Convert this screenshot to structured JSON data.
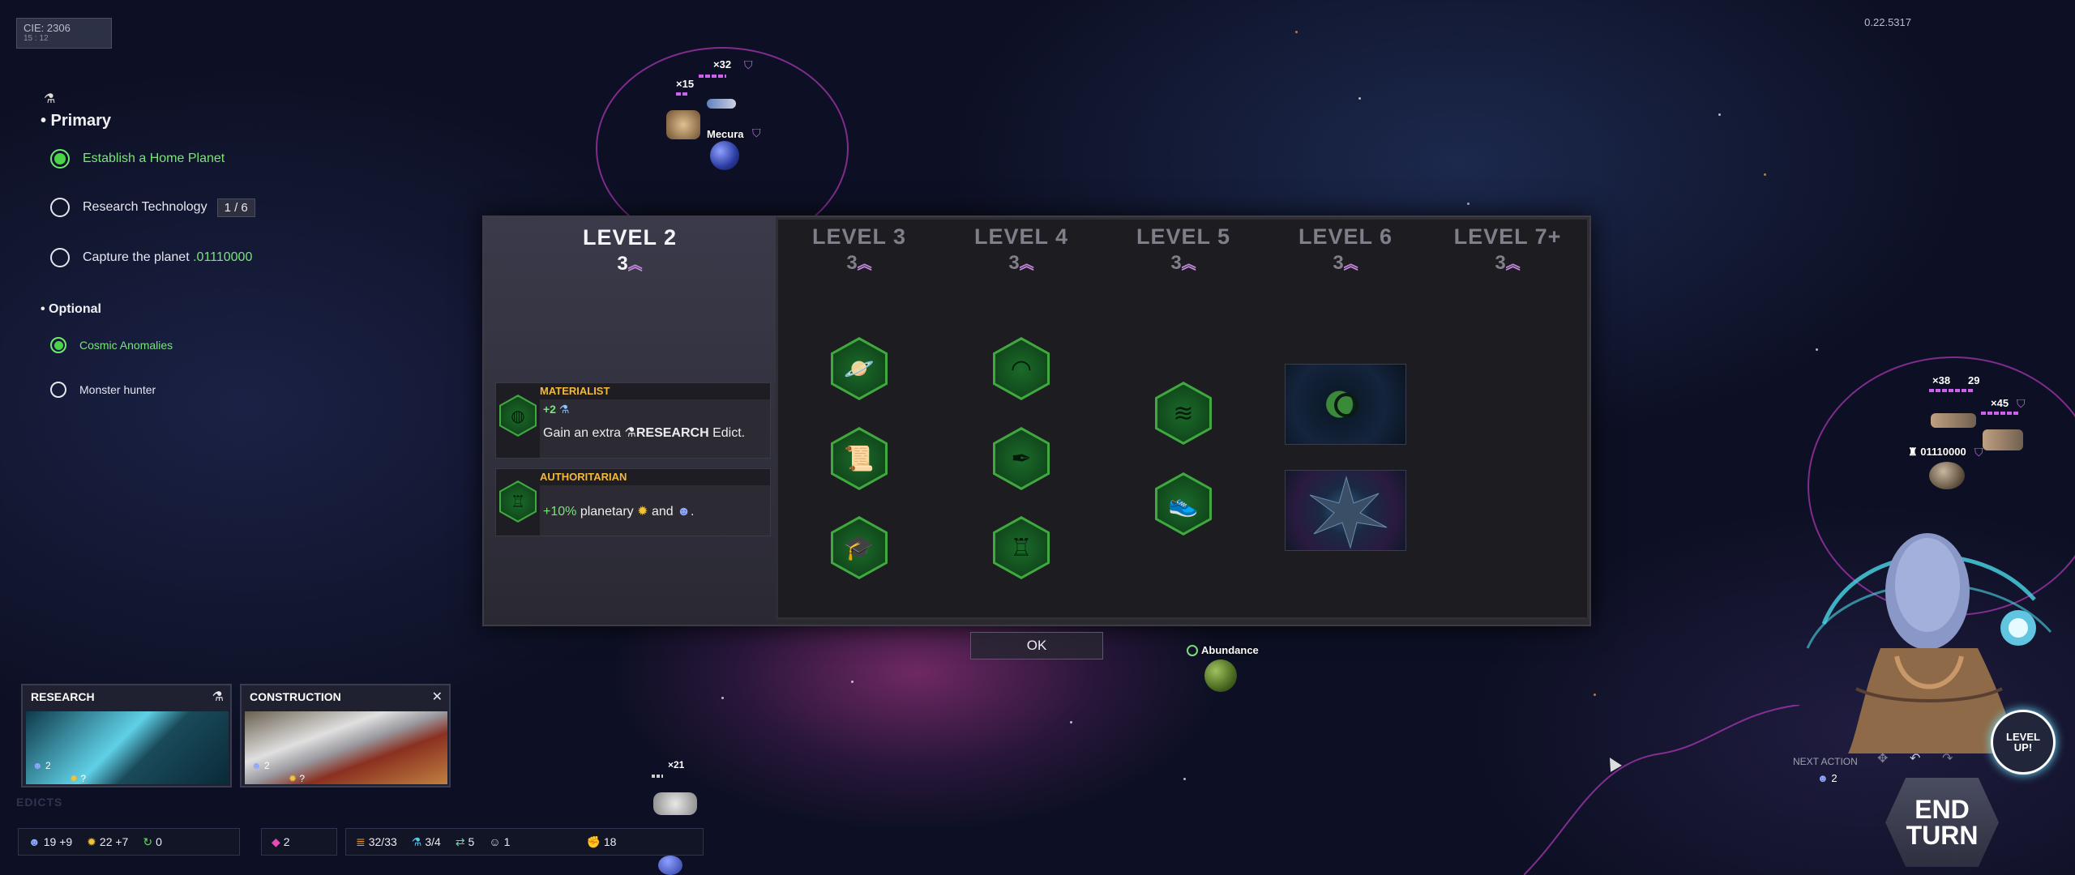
{
  "clock": {
    "label": "CIE: 2306",
    "sub": "15 : 12"
  },
  "version": "0.22.5317",
  "objectives": {
    "flask_icon": "flask-icon",
    "primary_heading": "• Primary",
    "primary": [
      {
        "label": "Establish a Home Planet",
        "done": true
      },
      {
        "label": "Research Technology",
        "badge": "1 / 6",
        "done": false
      },
      {
        "label": "Capture the planet ",
        "highlight": ".01110000",
        "done": false
      }
    ],
    "optional_heading": "• Optional",
    "optional": [
      {
        "label": "Cosmic Anomalies",
        "done": true
      },
      {
        "label": "Monster hunter",
        "done": false
      }
    ]
  },
  "map": {
    "fleet_a": "×32",
    "fleet_b": "×15",
    "planet_mecura": "Mecura",
    "fleet_c": "×21",
    "planet_abundance": "Abundance",
    "fleet_d": "×38",
    "fleet_d2": "29",
    "fleet_e": "×45",
    "planet_enemy": "01110000"
  },
  "modal": {
    "current": {
      "title": "LEVEL 2",
      "cost": "3"
    },
    "levels": [
      {
        "title": "LEVEL 3",
        "cost": "3"
      },
      {
        "title": "LEVEL 4",
        "cost": "3"
      },
      {
        "title": "LEVEL 5",
        "cost": "3"
      },
      {
        "title": "LEVEL 6",
        "cost": "3"
      },
      {
        "title": "LEVEL 7+",
        "cost": "3"
      }
    ],
    "edicts": [
      {
        "title": "MATERIALIST",
        "bonus": "+2",
        "desc_pre": "Gain an extra ",
        "desc_key": "RESEARCH",
        "desc_post": " Edict."
      },
      {
        "title": "AUTHORITARIAN",
        "bonus": "+10%",
        "desc": " planetary ",
        "desc_and": " and ",
        "desc_end": "."
      }
    ],
    "ok_label": "OK"
  },
  "cards": [
    {
      "title": "RESEARCH",
      "icon": "flask-icon",
      "pop": "2",
      "prod": "?"
    },
    {
      "title": "CONSTRUCTION",
      "icon": "tools-icon",
      "pop": "2",
      "prod": "?"
    }
  ],
  "edicts_label": "EDICTS",
  "resources": {
    "pop": "19 +9",
    "prod": "22 +7",
    "influence": "0",
    "cubes": "2",
    "storage": "32/33",
    "science": "3/4",
    "trade": "5",
    "culture": "1",
    "military": "18"
  },
  "next_action": {
    "label": "NEXT ACTION",
    "value": "2"
  },
  "end_turn": {
    "line1": "END",
    "line2": "TURN"
  },
  "level_up": {
    "line1": "LEVEL",
    "line2": "UP!"
  }
}
